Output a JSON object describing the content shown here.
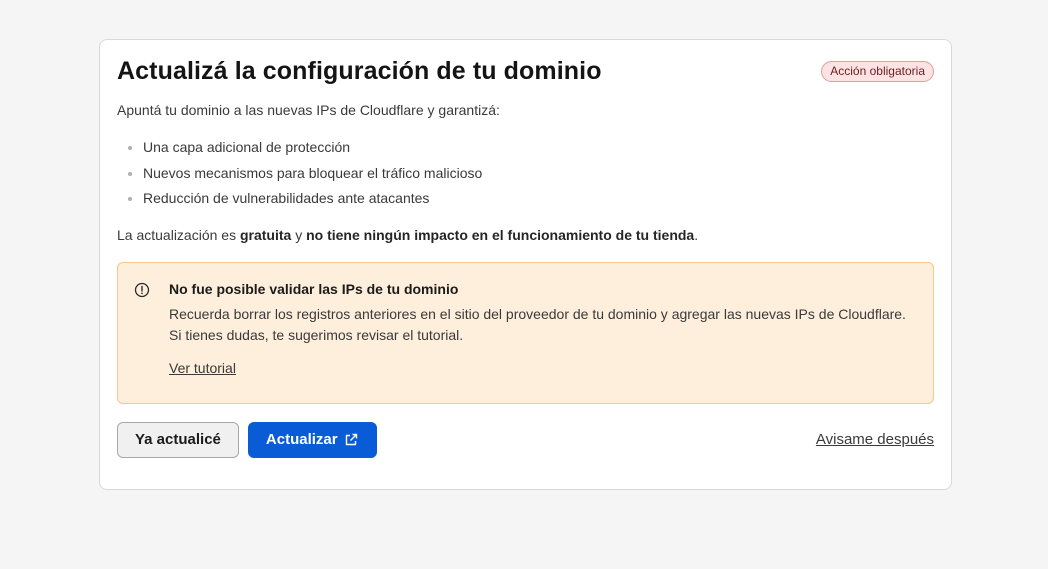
{
  "card": {
    "title": "Actualizá la configuración de tu dominio",
    "badge": "Acción obligatoria",
    "intro": "Apuntá tu dominio a las nuevas IPs de Cloudflare y garantizá:",
    "benefits": [
      "Una capa adicional de protección",
      "Nuevos mecanismos para bloquear el tráfico malicioso",
      "Reducción de vulnerabilidades ante atacantes"
    ],
    "note": {
      "prefix": "La actualización es ",
      "bold1": "gratuita",
      "middle": " y ",
      "bold2": "no tiene ningún impacto en el funcionamiento de tu tienda",
      "suffix": "."
    }
  },
  "alert": {
    "icon": "info-circle-icon",
    "title": "No fue posible validar las IPs de tu dominio",
    "text": "Recuerda borrar los registros anteriores en el sitio del proveedor de tu dominio y agregar las nuevas IPs de Cloudflare. Si tienes dudas, te sugerimos revisar el tutorial.",
    "link": "Ver tutorial"
  },
  "actions": {
    "secondary": "Ya actualicé",
    "primary": "Actualizar",
    "primary_icon": "external-link-icon",
    "later": "Avisame después"
  },
  "colors": {
    "primary": "#0a5bd6",
    "alert_bg": "#fdefdc",
    "alert_border": "#f3c98c",
    "badge_bg": "#fde3e3",
    "badge_border": "#e89a9c"
  }
}
